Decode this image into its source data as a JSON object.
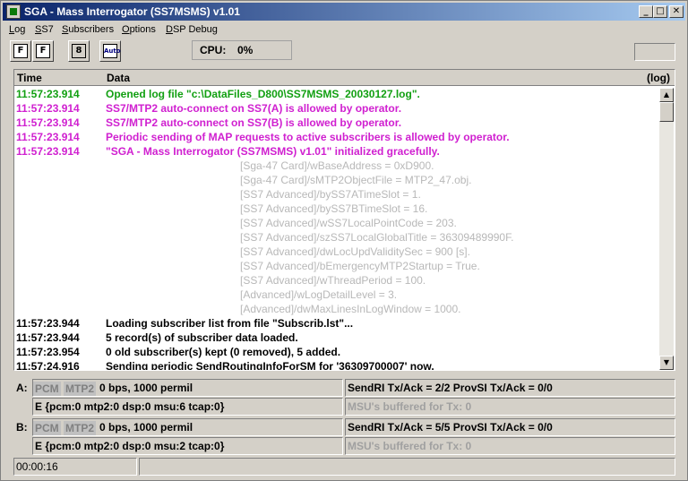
{
  "window": {
    "title": "SGA - Mass Interrogator (SS7MSMS) v1.01",
    "controls": {
      "minimize": "_",
      "maximize": "□",
      "close": "✕"
    }
  },
  "menu": [
    "Log",
    "SS7",
    "Subscribers",
    "Options",
    "DSP Debug"
  ],
  "toolbar": {
    "tools": [
      {
        "icon": "filter-f-icon",
        "glyph": "F"
      },
      {
        "icon": "filter-f2-icon",
        "glyph": "F"
      },
      {
        "icon": "device-icon",
        "glyph": "8"
      },
      {
        "icon": "auto-icon",
        "glyph": "Auto"
      }
    ],
    "cpu_label": "CPU:",
    "cpu_value": "0%"
  },
  "log": {
    "col_time": "Time",
    "col_data": "Data",
    "col_log": "(log)",
    "rows": [
      {
        "time": "11:57:23.914",
        "text": "Opened log file \"c:\\DataFiles_D800\\SS7MSMS_20030127.log\".",
        "style": "g"
      },
      {
        "time": "11:57:23.914",
        "text": "SS7/MTP2 auto-connect on SS7(A) is allowed by operator.",
        "style": "p"
      },
      {
        "time": "11:57:23.914",
        "text": "SS7/MTP2 auto-connect on SS7(B) is allowed by operator.",
        "style": "p"
      },
      {
        "time": "11:57:23.914",
        "text": "Periodic sending of MAP requests to active subscribers is allowed by operator.",
        "style": "p"
      },
      {
        "time": "11:57:23.914",
        "text": "\"SGA - Mass Interrogator (SS7MSMS) v1.01\" initialized gracefully.",
        "style": "p"
      },
      {
        "time": "",
        "text": "[Sga-47 Card]/wBaseAddress = 0xD900.",
        "style": "s"
      },
      {
        "time": "",
        "text": "[Sga-47 Card]/sMTP2ObjectFile = MTP2_47.obj.",
        "style": "s"
      },
      {
        "time": "",
        "text": "[SS7 Advanced]/bySS7ATimeSlot = 1.",
        "style": "s"
      },
      {
        "time": "",
        "text": "[SS7 Advanced]/bySS7BTimeSlot = 16.",
        "style": "s"
      },
      {
        "time": "",
        "text": "[SS7 Advanced]/wSS7LocalPointCode = 203.",
        "style": "s"
      },
      {
        "time": "",
        "text": "[SS7 Advanced]/szSS7LocalGlobalTitle = 36309489990F.",
        "style": "s"
      },
      {
        "time": "",
        "text": "[SS7 Advanced]/dwLocUpdValiditySec = 900 [s].",
        "style": "s"
      },
      {
        "time": "",
        "text": "[SS7 Advanced]/bEmergencyMTP2Startup = True.",
        "style": "s"
      },
      {
        "time": "",
        "text": "[SS7 Advanced]/wThreadPeriod = 100.",
        "style": "s"
      },
      {
        "time": "",
        "text": "[Advanced]/wLogDetailLevel = 3.",
        "style": "s"
      },
      {
        "time": "",
        "text": "[Advanced]/dwMaxLinesInLogWindow = 1000.",
        "style": "s"
      },
      {
        "time": "11:57:23.944",
        "text": "Loading subscriber list from file \"Subscrib.lst\"...",
        "style": "k"
      },
      {
        "time": "11:57:23.944",
        "text": "5 record(s) of subscriber data loaded.",
        "style": "k"
      },
      {
        "time": "11:57:23.954",
        "text": "0 old subscriber(s) kept (0 removed), 5 added.",
        "style": "k"
      },
      {
        "time": "11:57:24.916",
        "text": "Sending periodic SendRoutingInfoForSM for '36309700007' now.",
        "style": "k"
      }
    ]
  },
  "channels": [
    {
      "label": "A:",
      "pcm": "PCM",
      "mtp2": "MTP2",
      "rate": "0 bps, 1000 permil",
      "counters": "E {pcm:0  mtp2:0  dsp:0  msu:6  tcap:0}",
      "stats": "SendRI Tx/Ack = 2/2   ProvSI Tx/Ack = 0/0",
      "buffered": "MSU's buffered for Tx: 0"
    },
    {
      "label": "B:",
      "pcm": "PCM",
      "mtp2": "MTP2",
      "rate": "0 bps, 1000 permil",
      "counters": "E {pcm:0  mtp2:0  dsp:0  msu:2  tcap:0}",
      "stats": "SendRI Tx/Ack = 5/5   ProvSI Tx/Ack = 0/0",
      "buffered": "MSU's buffered for Tx: 0"
    }
  ],
  "status": {
    "elapsed": "00:00:16",
    "message": ""
  }
}
